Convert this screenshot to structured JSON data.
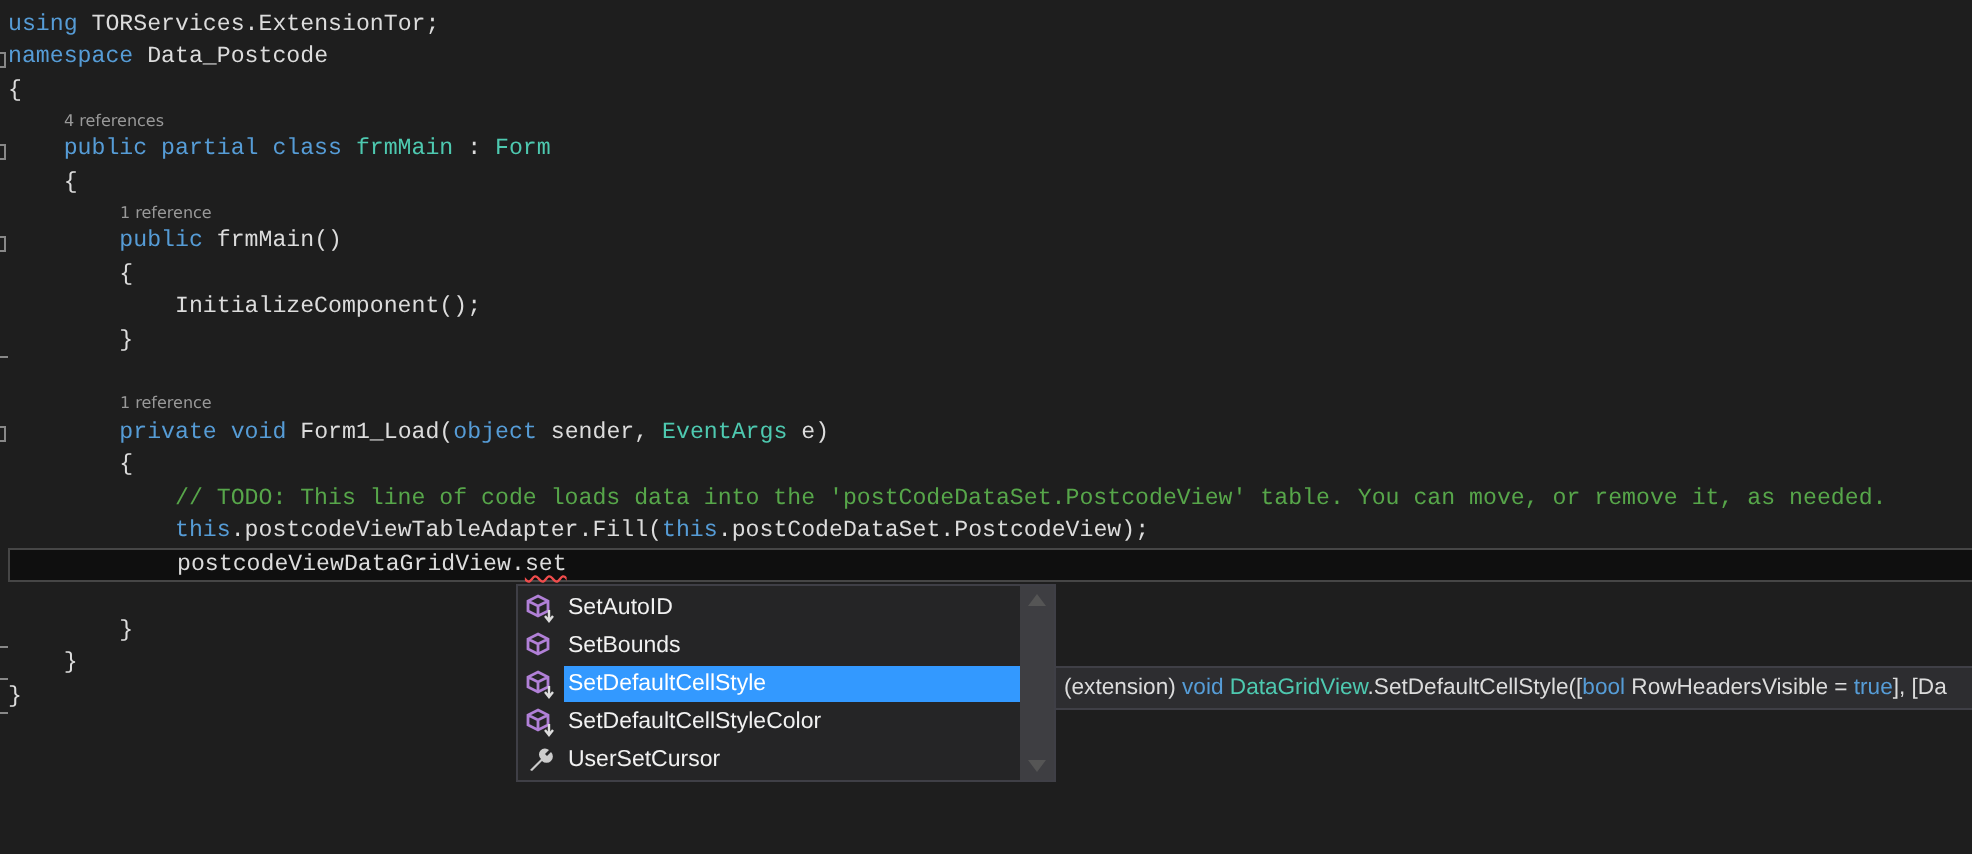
{
  "editor": {
    "lines": [
      {
        "kind": "code",
        "tokens": [
          {
            "kind": "kw",
            "text": "using"
          },
          {
            "kind": "plain",
            "text": " TORServices.ExtensionTor;"
          }
        ]
      },
      {
        "kind": "code",
        "fold_start": true,
        "tokens": [
          {
            "kind": "kw",
            "text": "namespace"
          },
          {
            "kind": "plain",
            "text": " Data_Postcode"
          }
        ]
      },
      {
        "kind": "code",
        "tokens": [
          {
            "kind": "plain",
            "text": "{"
          }
        ]
      },
      {
        "kind": "lens",
        "text": "4 references",
        "indented": true
      },
      {
        "kind": "code",
        "fold_start": true,
        "tokens": [
          {
            "kind": "kw",
            "text": "    public partial class "
          },
          {
            "kind": "type",
            "text": "frmMain"
          },
          {
            "kind": "plain",
            "text": " : "
          },
          {
            "kind": "type",
            "text": "Form"
          }
        ]
      },
      {
        "kind": "code",
        "tokens": [
          {
            "kind": "plain",
            "text": "    {"
          }
        ]
      },
      {
        "kind": "lens",
        "text": "1 reference",
        "indented": true
      },
      {
        "kind": "code",
        "fold_start": true,
        "tokens": [
          {
            "kind": "kw",
            "text": "        public"
          },
          {
            "kind": "plain",
            "text": " frmMain()"
          }
        ]
      },
      {
        "kind": "code",
        "tokens": [
          {
            "kind": "plain",
            "text": "        {"
          }
        ]
      },
      {
        "kind": "code",
        "tokens": [
          {
            "kind": "plain",
            "text": "            InitializeComponent();"
          }
        ]
      },
      {
        "kind": "code",
        "fold_end": true,
        "tokens": [
          {
            "kind": "plain",
            "text": "        }"
          }
        ]
      },
      {
        "kind": "blank"
      },
      {
        "kind": "lens",
        "text": "1 reference",
        "indented": true
      },
      {
        "kind": "code",
        "fold_start": true,
        "tokens": [
          {
            "kind": "kw",
            "text": "        private void"
          },
          {
            "kind": "plain",
            "text": " Form1_Load("
          },
          {
            "kind": "kw",
            "text": "object"
          },
          {
            "kind": "plain",
            "text": " sender, "
          },
          {
            "kind": "type",
            "text": "EventArgs"
          },
          {
            "kind": "plain",
            "text": " e)"
          }
        ]
      },
      {
        "kind": "code",
        "tokens": [
          {
            "kind": "plain",
            "text": "        {"
          }
        ]
      },
      {
        "kind": "code",
        "tokens": [
          {
            "kind": "comment",
            "text": "            // TODO: This line of code loads data into the 'postCodeDataSet.PostcodeView' table. You can move, or remove it, as needed."
          }
        ]
      },
      {
        "kind": "code",
        "tokens": [
          {
            "kind": "kw",
            "text": "            this"
          },
          {
            "kind": "plain",
            "text": ".postcodeViewTableAdapter.Fill("
          },
          {
            "kind": "kw",
            "text": "this"
          },
          {
            "kind": "plain",
            "text": ".postCodeDataSet.PostcodeView);"
          }
        ]
      },
      {
        "kind": "code",
        "current": true,
        "tokens": [
          {
            "kind": "plain",
            "text": "            postcodeViewDataGridView."
          },
          {
            "kind": "error",
            "text": "set"
          }
        ]
      },
      {
        "kind": "blank"
      },
      {
        "kind": "code",
        "fold_end": true,
        "tokens": [
          {
            "kind": "plain",
            "text": "        }"
          }
        ]
      },
      {
        "kind": "code",
        "fold_end": true,
        "tokens": [
          {
            "kind": "plain",
            "text": "    }"
          }
        ]
      },
      {
        "kind": "code",
        "fold_end": true,
        "tokens": [
          {
            "kind": "plain",
            "text": "}"
          }
        ]
      }
    ]
  },
  "completion": {
    "items": [
      {
        "kind": "extension",
        "label": "SetAutoID",
        "selected": false
      },
      {
        "kind": "method",
        "label": "SetBounds",
        "selected": false
      },
      {
        "kind": "extension",
        "label": "SetDefaultCellStyle",
        "selected": true
      },
      {
        "kind": "extension",
        "label": "SetDefaultCellStyleColor",
        "selected": false
      },
      {
        "kind": "property",
        "label": "UserSetCursor",
        "selected": false
      }
    ]
  },
  "tooltip": {
    "tokens": [
      {
        "kind": "plain",
        "text": "(extension) "
      },
      {
        "kind": "kw",
        "text": "void "
      },
      {
        "kind": "type",
        "text": "DataGridView"
      },
      {
        "kind": "plain",
        "text": ".SetDefaultCellStyle(["
      },
      {
        "kind": "kw",
        "text": "bool"
      },
      {
        "kind": "plain",
        "text": " RowHeadersVisible = "
      },
      {
        "kind": "kw",
        "text": "true"
      },
      {
        "kind": "plain",
        "text": "], [Da"
      }
    ]
  }
}
